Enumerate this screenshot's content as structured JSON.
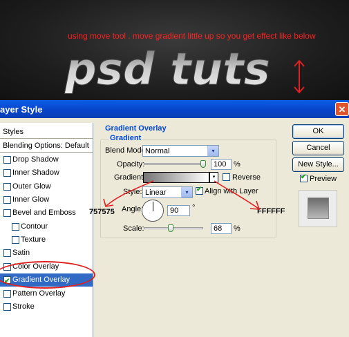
{
  "banner": {
    "note": "using move tool . move gradient little up so you get effect like below",
    "logo_text": "psd tuts"
  },
  "dialog": {
    "title": "ayer Style",
    "close_symbol": "✕"
  },
  "styles": {
    "header": "Styles",
    "blending": "Blending Options: Default",
    "items": [
      {
        "label": "Drop Shadow",
        "checked": false
      },
      {
        "label": "Inner Shadow",
        "checked": false
      },
      {
        "label": "Outer Glow",
        "checked": false
      },
      {
        "label": "Inner Glow",
        "checked": false
      },
      {
        "label": "Bevel and Emboss",
        "checked": false
      },
      {
        "label": "Contour",
        "checked": false
      },
      {
        "label": "Texture",
        "checked": false
      },
      {
        "label": "Satin",
        "checked": false
      },
      {
        "label": "Color Overlay",
        "checked": false
      },
      {
        "label": "Gradient Overlay",
        "checked": true,
        "selected": true
      },
      {
        "label": "Pattern Overlay",
        "checked": false
      },
      {
        "label": "Stroke",
        "checked": false
      }
    ],
    "check_symbol": "✔"
  },
  "panel": {
    "section_title": "Gradient Overlay",
    "group_title": "Gradient",
    "blend_mode_label": "Blend Mode:",
    "blend_mode_value": "Normal",
    "opacity_label": "Opacity:",
    "opacity_value": "100",
    "opacity_unit": "%",
    "opacity_level": 1.0,
    "gradient_label": "Gradient:",
    "reverse_label": "Reverse",
    "reverse_checked": false,
    "style_label": "Style:",
    "style_value": "Linear",
    "align_label": "Align with Layer",
    "align_checked": true,
    "angle_label": "Angle:",
    "angle_value": "90",
    "angle_unit": "°",
    "scale_label": "Scale:",
    "scale_value": "68",
    "scale_unit": "%",
    "scale_level": 0.45,
    "dropdown_symbol": "▾",
    "gradient_start_color": "#757575",
    "gradient_end_color": "#ffffff"
  },
  "annotations": {
    "left_hex": "757575",
    "right_hex": "FFFFFF",
    "accent": "#e02020"
  },
  "buttons": {
    "ok": "OK",
    "cancel": "Cancel",
    "new_style": "New Style...",
    "preview_label": "Preview",
    "preview_checked": true
  }
}
